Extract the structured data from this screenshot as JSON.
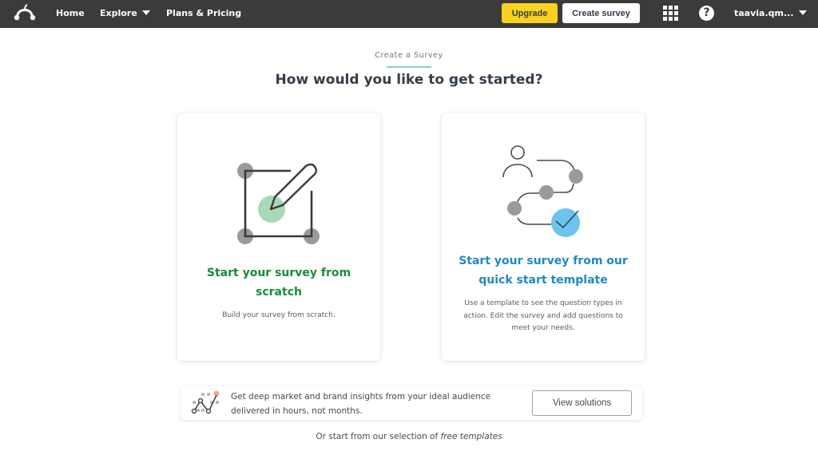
{
  "nav": {
    "logo_icon": "surveymonkey-logo-icon",
    "home": "Home",
    "explore": "Explore",
    "plans": "Plans & Pricing",
    "upgrade": "Upgrade",
    "create_survey": "Create survey",
    "apps_icon": "grid-icon",
    "help_icon": "question-icon",
    "help_glyph": "?",
    "user": "taavia.qm...",
    "colors": {
      "bar": "#3b3b3b",
      "upgrade": "#f9d21e"
    }
  },
  "header": {
    "eyebrow": "Create a Survey",
    "title": "How would you like to get started?"
  },
  "cards": [
    {
      "id": "scratch",
      "icon": "edit-square-icon",
      "title": "Start your survey from scratch",
      "description": "Build your survey from scratch.",
      "title_color": "#1a8a3a"
    },
    {
      "id": "template",
      "icon": "template-flow-icon",
      "title": "Start your survey from our quick start template",
      "description": "Use a template to see the question types in action. Edit the survey and add questions to meet your needs.",
      "title_color": "#1f8ac0"
    }
  ],
  "promo": {
    "icon": "insights-chart-icon",
    "text": "Get deep market and brand insights from your ideal audience delivered in hours, not months.",
    "button": "View solutions"
  },
  "footer": {
    "prefix": "Or start from our selection of ",
    "link": "free templates"
  }
}
